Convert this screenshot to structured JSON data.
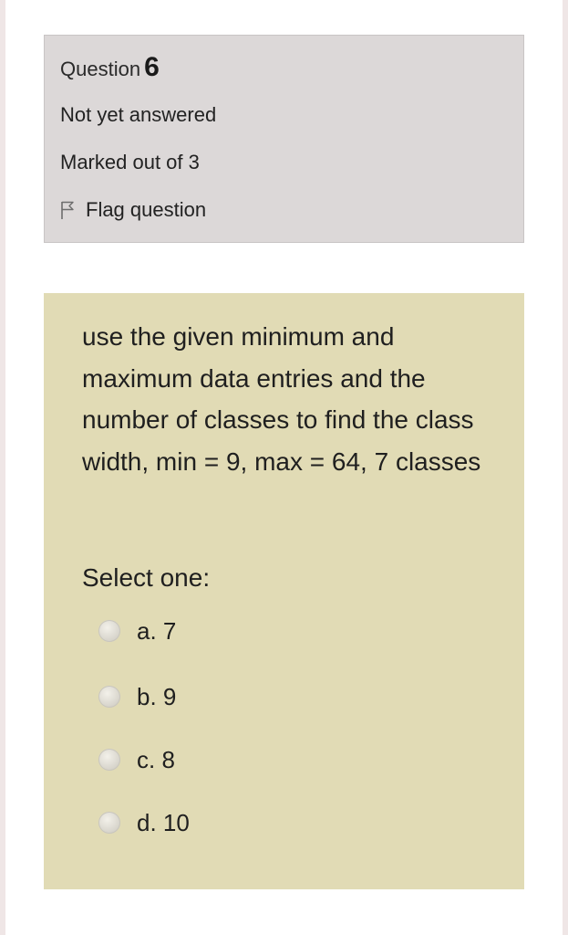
{
  "info": {
    "question_label": "Question",
    "question_number": "6",
    "status": "Not yet answered",
    "marks": "Marked out of 3",
    "flag_icon": "flag-icon",
    "flag_label": "Flag question"
  },
  "question": {
    "text": "use the given minimum and maximum data entries and the number of classes to find the class width, min = 9, max = 64, 7 classes",
    "prompt": "Select one:",
    "options": [
      {
        "label": "a. 7"
      },
      {
        "label": "b. 9"
      },
      {
        "label": "c. 8"
      },
      {
        "label": "d. 10"
      }
    ]
  },
  "colors": {
    "info_background": "#dcd8d8",
    "question_background": "#e1dbb5",
    "page_background": "#ffffff"
  }
}
